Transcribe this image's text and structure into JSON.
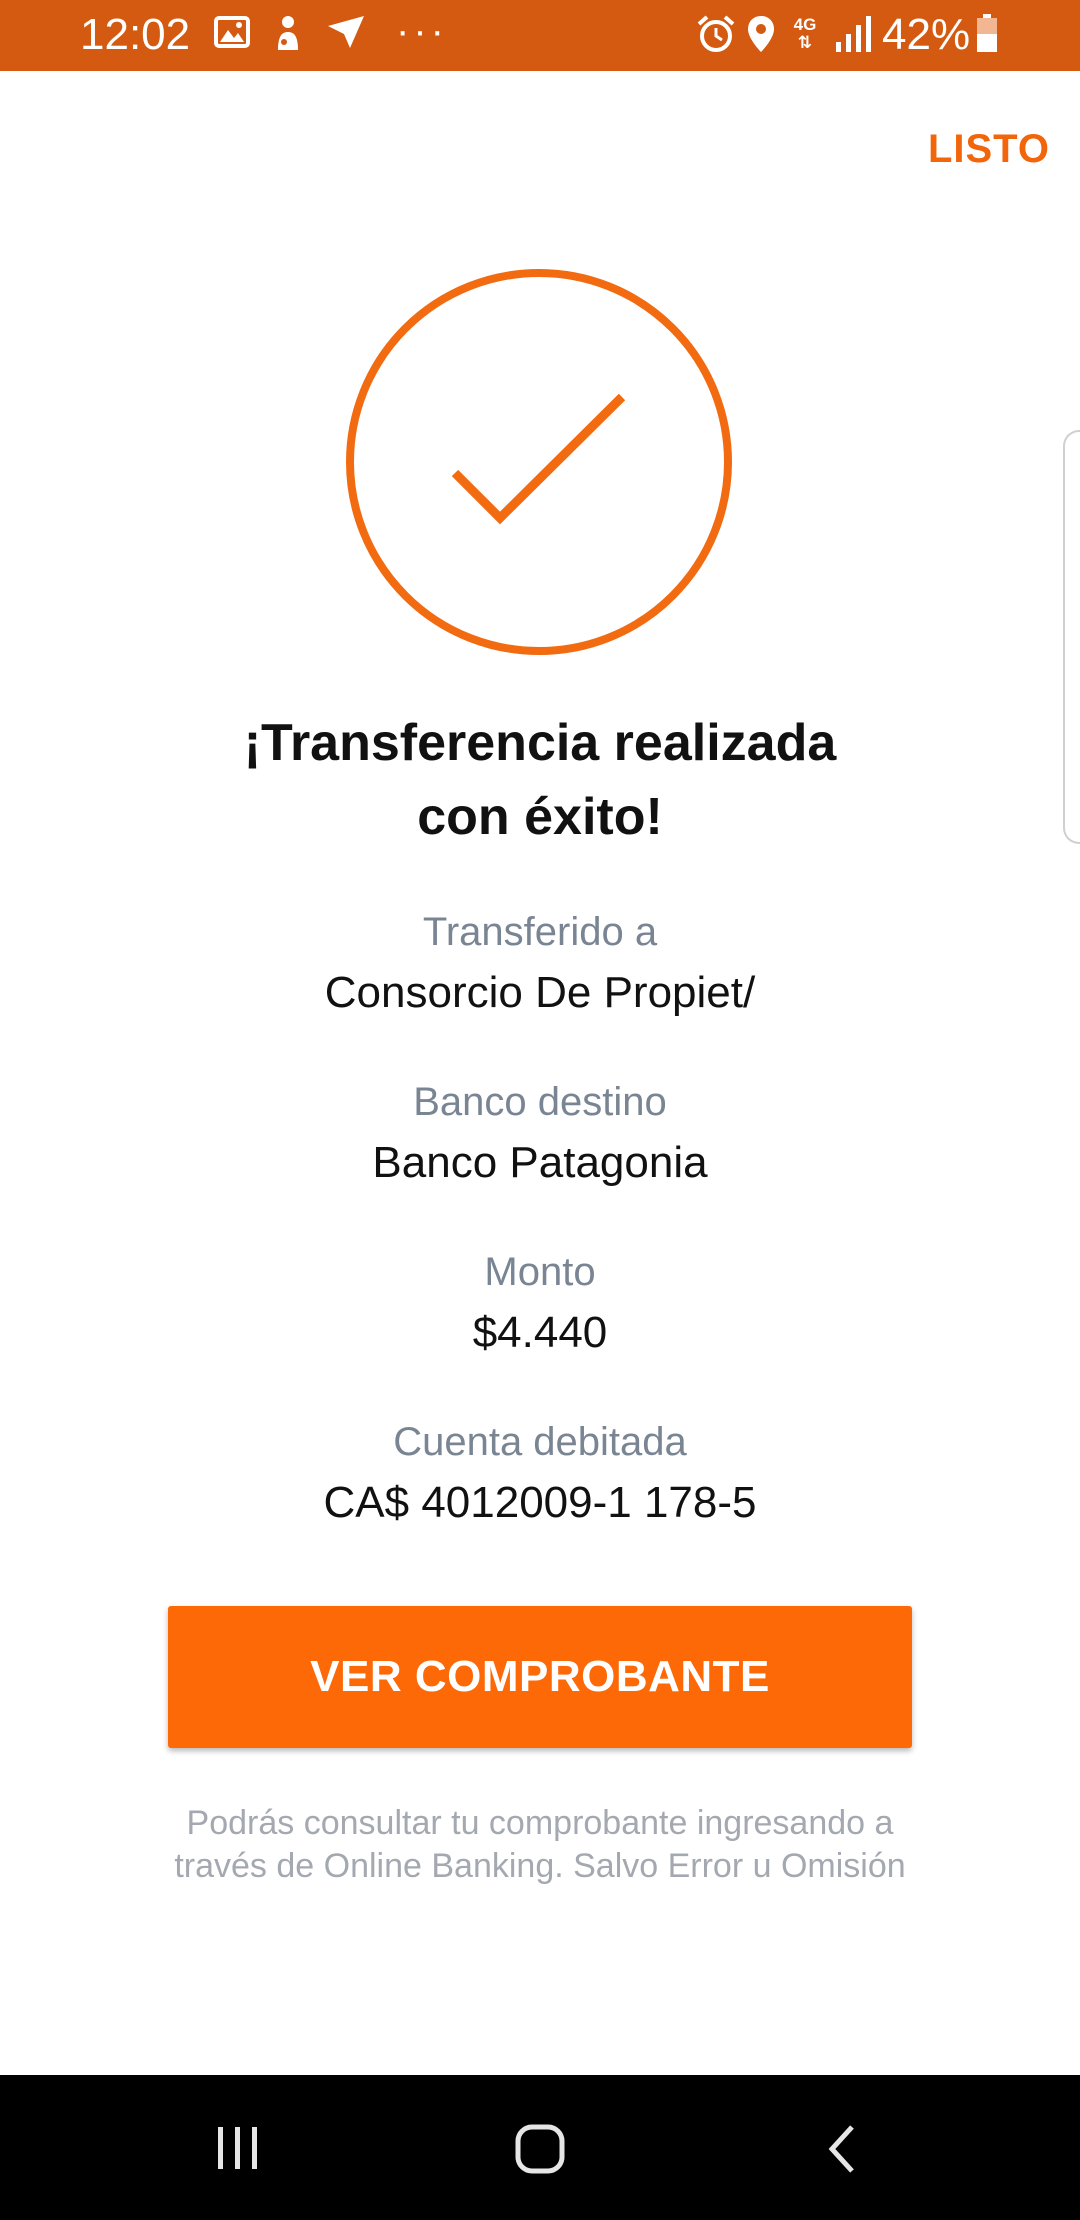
{
  "status_bar": {
    "time": "12:02",
    "network": "4G",
    "battery": "42%",
    "more": "···",
    "icons": [
      "image-icon",
      "person-icon",
      "send-icon",
      "alarm-icon",
      "location-icon",
      "signal-icon",
      "battery-icon"
    ]
  },
  "header": {
    "done_label": "LISTO"
  },
  "success": {
    "icon": "check-circle-icon",
    "title_line1": "¡Transferencia realizada",
    "title_line2": "con éxito!"
  },
  "details": [
    {
      "label": "Transferido a",
      "value": "Consorcio De Propiet/"
    },
    {
      "label": "Banco destino",
      "value": "Banco Patagonia"
    },
    {
      "label": "Monto",
      "value": "$4.440"
    },
    {
      "label": "Cuenta debitada",
      "value": "CA$ 4012009-1 178-5"
    }
  ],
  "actions": {
    "view_receipt_label": "VER COMPROBANTE"
  },
  "disclaimer": "Podrás consultar tu comprobante ingresando a través de Online Banking. Salvo Error u Omisión",
  "nav_bar": {
    "buttons": [
      "recent-apps-icon",
      "home-icon",
      "back-icon"
    ]
  },
  "colors": {
    "accent": "#fe6907",
    "status_bar": "#d35a10",
    "label_gray": "#7a8594"
  }
}
